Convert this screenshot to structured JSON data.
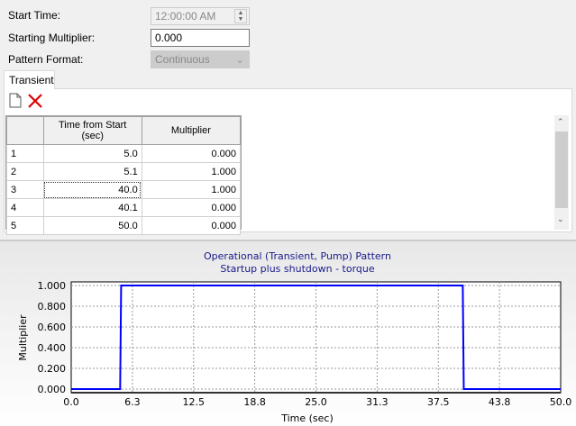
{
  "form": {
    "start_time_label": "Start Time:",
    "start_time_value": "12:00:00 AM",
    "starting_multiplier_label": "Starting Multiplier:",
    "starting_multiplier_value": "0.000",
    "pattern_format_label": "Pattern Format:",
    "pattern_format_value": "Continuous"
  },
  "tab": "Transient",
  "toolbar": {
    "new_icon": "new-document-icon",
    "delete_icon": "delete-x-icon"
  },
  "table": {
    "headers": [
      "Time from Start\n(sec)",
      "Multiplier"
    ],
    "header_time_1": "Time from Start",
    "header_time_2": "(sec)",
    "header_mult": "Multiplier",
    "rows": [
      {
        "n": "1",
        "time": "5.0",
        "mult": "0.000"
      },
      {
        "n": "2",
        "time": "5.1",
        "mult": "1.000"
      },
      {
        "n": "3",
        "time": "40.0",
        "mult": "1.000"
      },
      {
        "n": "4",
        "time": "40.1",
        "mult": "0.000"
      },
      {
        "n": "5",
        "time": "50.0",
        "mult": "0.000"
      }
    ]
  },
  "chart_data": {
    "type": "line",
    "title": "Operational (Transient, Pump) Pattern",
    "subtitle": "Startup plus shutdown - torque",
    "xlabel": "Time (sec)",
    "ylabel": "Multiplier",
    "x": [
      0,
      5.0,
      5.1,
      40.0,
      40.1,
      50.0
    ],
    "y": [
      0,
      0,
      1,
      1,
      0,
      0
    ],
    "xlim": [
      0,
      50
    ],
    "ylim": [
      0,
      1
    ],
    "xticks": [
      "0.0",
      "6.3",
      "12.5",
      "18.8",
      "25.0",
      "31.3",
      "37.5",
      "43.8",
      "50.0"
    ],
    "yticks": [
      "0.000",
      "0.200",
      "0.400",
      "0.600",
      "0.800",
      "1.000"
    ],
    "grid": true,
    "line_color": "#0000ff"
  }
}
